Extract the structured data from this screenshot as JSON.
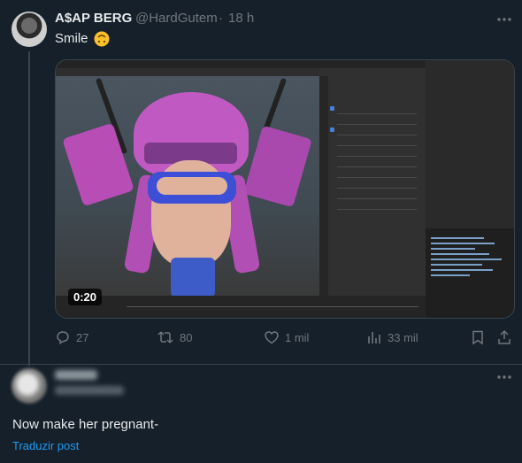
{
  "tweet": {
    "display_name": "A$AP BERG",
    "handle": "@HardGutem",
    "separator": "·",
    "time": "18 h",
    "text": "Smile",
    "emoji": "upside-down-face-emoji",
    "media": {
      "video_duration": "0:20"
    },
    "actions": {
      "replies": "27",
      "reposts": "80",
      "likes": "1 mil",
      "views": "33 mil"
    }
  },
  "reply": {
    "text": "Now make her pregnant-",
    "translate_label": "Traduzir post"
  },
  "colors": {
    "background": "#15202b",
    "text_primary": "#e7e9ea",
    "text_secondary": "#71767b",
    "link": "#1d9bf0",
    "border": "#38444d"
  }
}
